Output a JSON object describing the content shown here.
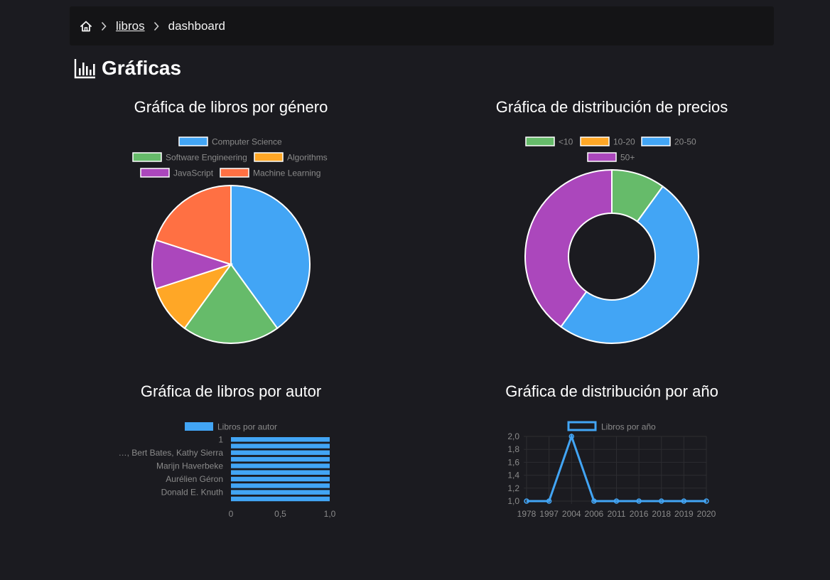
{
  "breadcrumb": {
    "home_icon": "home-icon",
    "separator_icon": "chevron-right-icon",
    "libros": "libros",
    "current": "dashboard"
  },
  "page": {
    "icon": "bar-chart-icon",
    "title": "Gráficas"
  },
  "colors": {
    "blue": "#42a5f5",
    "green": "#66bb6a",
    "orange": "#ffa726",
    "purple": "#ab47bc",
    "red": "#ff7043",
    "background": "#1b1b20",
    "legend_text": "#8a8a8a"
  },
  "chart_data": [
    {
      "type": "pie",
      "title": "Gráfica de libros por género",
      "categories": [
        "Computer Science",
        "Software Engineering",
        "Algorithms",
        "JavaScript",
        "Machine Learning"
      ],
      "values": [
        4,
        2,
        1,
        1,
        2
      ],
      "colors": [
        "#42a5f5",
        "#66bb6a",
        "#ffa726",
        "#ab47bc",
        "#ff7043"
      ],
      "legend": "top"
    },
    {
      "type": "doughnut",
      "title": "Gráfica de distribución de precios",
      "categories": [
        "<10",
        "10-20",
        "20-50",
        "50+"
      ],
      "values": [
        1,
        0,
        5,
        4
      ],
      "colors": [
        "#66bb6a",
        "#ffa726",
        "#42a5f5",
        "#ab47bc"
      ],
      "legend": "top"
    },
    {
      "type": "bar",
      "orientation": "horizontal",
      "title": "Gráfica de libros por autor",
      "series": [
        {
          "name": "Libros por autor",
          "color": "#42a5f5"
        }
      ],
      "categories": [
        "1",
        "",
        "…, Bert Bates, Kathy Sierra",
        "",
        "Marijn Haverbeke",
        "",
        "Aurélien Géron",
        "",
        "Donald E. Knuth",
        ""
      ],
      "values": [
        1,
        1,
        1,
        1,
        1,
        1,
        1,
        1,
        1,
        1
      ],
      "xticks": [
        "0",
        "0,5",
        "1,0"
      ],
      "xlim": [
        0,
        1
      ],
      "legend": "top"
    },
    {
      "type": "line",
      "title": "Gráfica de distribución por año",
      "series": [
        {
          "name": "Libros por año",
          "color": "#42a5f5"
        }
      ],
      "x": [
        "1978",
        "1997",
        "2004",
        "2006",
        "2011",
        "2016",
        "2018",
        "2019",
        "2020"
      ],
      "values": [
        1,
        1,
        2,
        1,
        1,
        1,
        1,
        1,
        1
      ],
      "yticks": [
        "2,0",
        "1,8",
        "1,6",
        "1,4",
        "1,2",
        "1,0"
      ],
      "ylim": [
        1,
        2
      ],
      "grid": true,
      "legend": "top"
    }
  ]
}
